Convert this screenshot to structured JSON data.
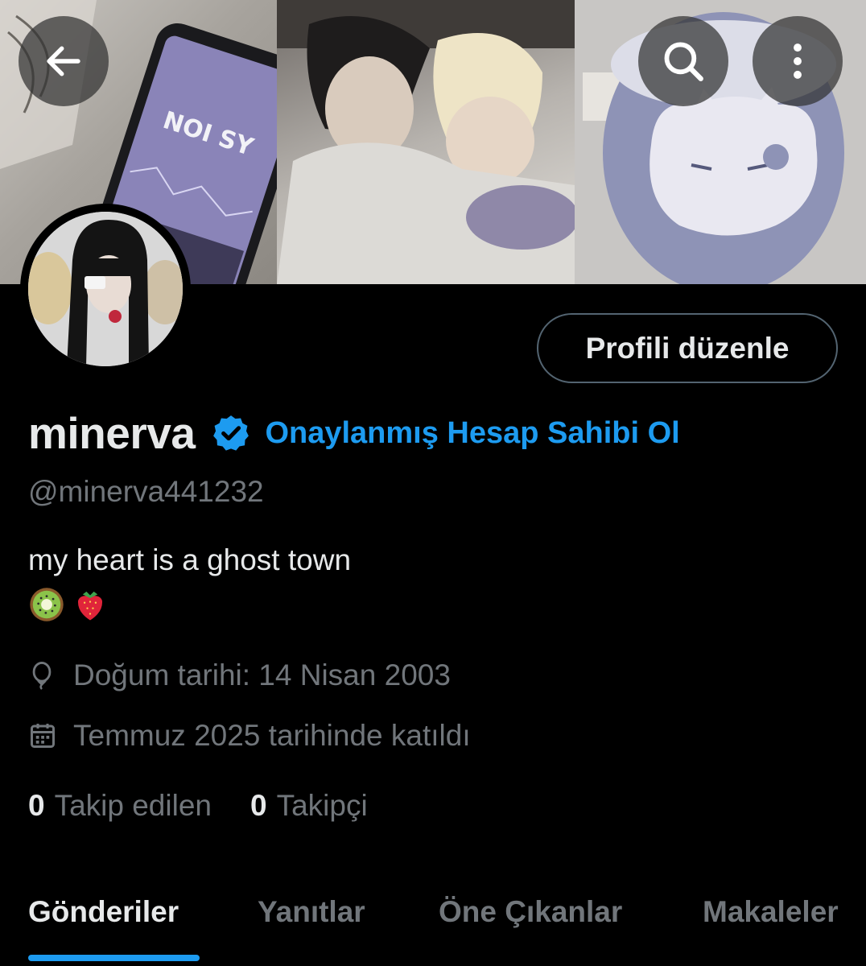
{
  "profile": {
    "name": "minerva",
    "verify_cta": "Onaylanmış Hesap Sahibi Ol",
    "handle": "@minerva441232",
    "bio": "my heart is a ghost town",
    "bio_emojis": [
      "kiwi",
      "strawberry"
    ],
    "birthday": "Doğum tarihi: 14 Nisan 2003",
    "joined": "Temmuz 2025 tarihinde katıldı",
    "following_count": "0",
    "following_label": "Takip edilen",
    "followers_count": "0",
    "followers_label": "Takipçi"
  },
  "header": {
    "back_icon": "arrow-left-icon",
    "search_icon": "search-icon",
    "more_icon": "more-vertical-icon",
    "edit_profile_label": "Profili düzenle"
  },
  "banner": {
    "phone_text": "NOI SY"
  },
  "tabs": [
    {
      "label": "Gönderiler",
      "active": true
    },
    {
      "label": "Yanıtlar",
      "active": false
    },
    {
      "label": "Öne Çıkanlar",
      "active": false
    },
    {
      "label": "Makaleler",
      "active": false
    }
  ],
  "colors": {
    "accent": "#1d9bf0",
    "background": "#000000",
    "primary_text": "#e7e9ea",
    "secondary_text": "#71767b",
    "border": "#536471"
  }
}
